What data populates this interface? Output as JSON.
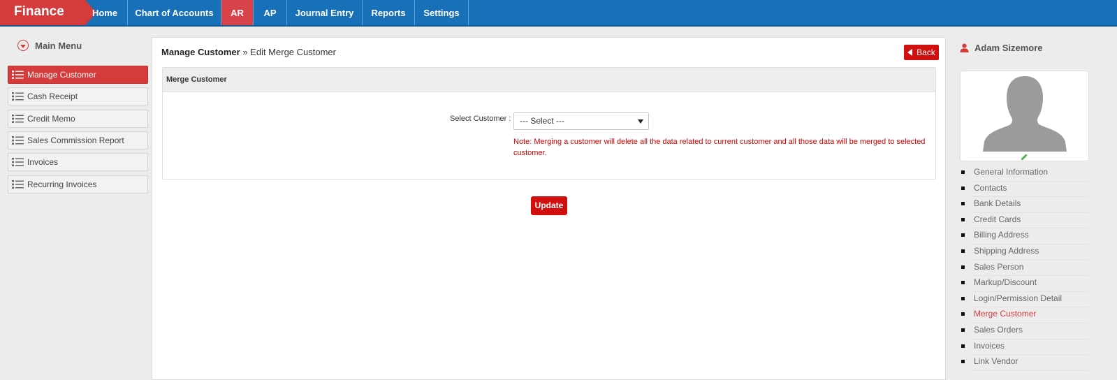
{
  "brand": "Finance",
  "nav": [
    {
      "label": "Home",
      "active": false
    },
    {
      "label": "Chart of Accounts",
      "active": false
    },
    {
      "label": "AR",
      "active": true
    },
    {
      "label": "AP",
      "active": false
    },
    {
      "label": "Journal Entry",
      "active": false
    },
    {
      "label": "Reports",
      "active": false
    },
    {
      "label": "Settings",
      "active": false
    }
  ],
  "sidebar": {
    "title": "Main Menu",
    "items": [
      {
        "label": "Manage Customer",
        "active": true
      },
      {
        "label": "Cash Receipt",
        "active": false
      },
      {
        "label": "Credit Memo",
        "active": false
      },
      {
        "label": "Sales Commission Report",
        "active": false
      },
      {
        "label": "Invoices",
        "active": false
      },
      {
        "label": "Recurring Invoices",
        "active": false
      }
    ]
  },
  "main": {
    "breadcrumb": {
      "parent": "Manage Customer",
      "separator": " » ",
      "current": "Edit Merge Customer"
    },
    "back_label": "Back",
    "section_title": "Merge Customer",
    "select_label": "Select Customer :",
    "select_value": "--- Select ---",
    "note": "Note: Merging a customer will delete all the data related to current customer and all those data will be merged to selected customer.",
    "update_label": "Update"
  },
  "user": {
    "name": "Adam Sizemore",
    "links": [
      {
        "label": "General Information",
        "active": false
      },
      {
        "label": "Contacts",
        "active": false
      },
      {
        "label": "Bank Details",
        "active": false
      },
      {
        "label": "Credit Cards",
        "active": false
      },
      {
        "label": "Billing Address",
        "active": false
      },
      {
        "label": "Shipping Address",
        "active": false
      },
      {
        "label": "Sales Person",
        "active": false
      },
      {
        "label": "Markup/Discount",
        "active": false
      },
      {
        "label": "Login/Permission Detail",
        "active": false
      },
      {
        "label": "Merge Customer",
        "active": true
      },
      {
        "label": "Sales Orders",
        "active": false
      },
      {
        "label": "Invoices",
        "active": false
      },
      {
        "label": "Link Vendor",
        "active": false
      }
    ]
  },
  "colors": {
    "nav_blue": "#1770b8",
    "accent_red": "#d63b3b",
    "button_red": "#d20f0f",
    "note_red": "#d00000"
  }
}
